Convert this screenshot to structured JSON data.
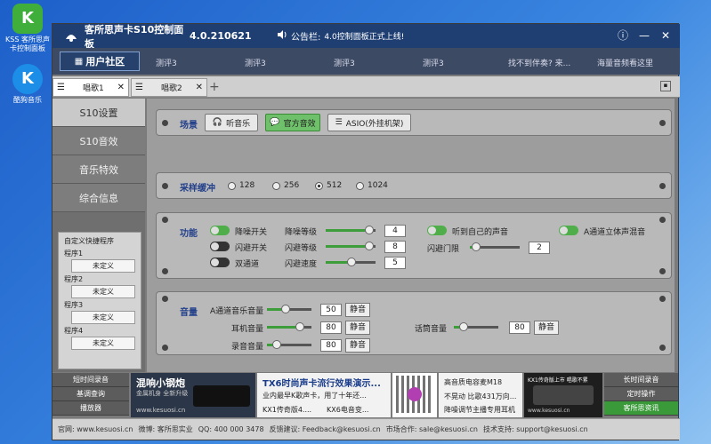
{
  "desktop": {
    "icons": [
      {
        "label": "KSS 客所思声卡控制面板",
        "glyph": "K"
      },
      {
        "label": "酷狗音乐",
        "glyph": "K"
      }
    ]
  },
  "titlebar": {
    "app_title": "客所思声卡S10控制面板",
    "version": "4.0.210621",
    "notice_label": "公告栏:",
    "notice_text": "4.0控制面板正式上线!",
    "info_glyph": "ⓘ",
    "minimize_glyph": "—",
    "close_glyph": "✕"
  },
  "navbar": {
    "community_label": "用户社区",
    "links": [
      "测评3",
      "测评3",
      "测评3",
      "测评3",
      "找不到伴奏? 来...",
      "海量音频看这里"
    ]
  },
  "tabs": [
    {
      "label": "唱歌1",
      "active": true
    },
    {
      "label": "唱歌2",
      "active": false
    }
  ],
  "sidebar": {
    "items": [
      {
        "label": "S10设置",
        "active": true
      },
      {
        "label": "S10音效",
        "active": false
      },
      {
        "label": "音乐特效",
        "active": false
      },
      {
        "label": "综合信息",
        "active": false
      }
    ],
    "shortcut_title": "自定义快捷程序",
    "programs": [
      {
        "label": "程序1",
        "button": "未定义"
      },
      {
        "label": "程序2",
        "button": "未定义"
      },
      {
        "label": "程序3",
        "button": "未定义"
      },
      {
        "label": "程序4",
        "button": "未定义"
      }
    ]
  },
  "scene": {
    "label": "场景",
    "buttons": [
      {
        "label": "听音乐",
        "icon": "headphones-icon",
        "active": false
      },
      {
        "label": "官方音效",
        "icon": "chat-icon",
        "active": true
      },
      {
        "label": "ASIO(外挂机架)",
        "icon": "sliders-icon",
        "active": false
      }
    ]
  },
  "sampling": {
    "label": "采样缓冲",
    "options": [
      "128",
      "256",
      "512",
      "1024"
    ],
    "selected": "512"
  },
  "function": {
    "label": "功能",
    "denoise_label": "降噪开关",
    "denoise_on": true,
    "denoise_level_label": "降噪等级",
    "denoise_level": "4",
    "flash_label": "闪避开关",
    "flash_on": false,
    "flash_level_label": "闪避等级",
    "flash_level": "8",
    "dual_label": "双通道",
    "dual_on": false,
    "flash_speed_label": "闪避速度",
    "flash_speed": "5",
    "hear_self_label": "听到自己的声音",
    "hear_self_on": true,
    "flash_threshold_label": "闪避门限",
    "flash_threshold": "2",
    "stereo_label": "A通道立体声混音",
    "stereo_on": true
  },
  "volume": {
    "label": "音量",
    "a_music_label": "A通道音乐音量",
    "a_music": "50",
    "earphone_label": "耳机音量",
    "earphone": "80",
    "record_label": "录音音量",
    "record": "80",
    "mic_label": "话筒音量",
    "mic": "80",
    "mute_label": "静音"
  },
  "footer_left": [
    "短时间录音",
    "基调查询",
    "播放器"
  ],
  "banners": {
    "b1_title": "混响小钢炮",
    "b1_sub": "金属机身 全新升级",
    "b1_site": "www.kesuosi.cn",
    "b2_title": "TX6时尚声卡流行效果演示...",
    "b2_line1": "业内最早K歌声卡，用了十年还...",
    "b2_line2a": "KX1传奇版4....",
    "b2_line2b": "KX6电音变...",
    "b3_line1": "高音质电容麦M18",
    "b3_line2": "不晃动 比歌431万向...",
    "b3_line3": "降噪调节主播专用耳机",
    "b4_title": "KX1传奇版上市 唱歌不累",
    "b4_site": "www.kesuosi.cn"
  },
  "footer_right": [
    "长时间录音",
    "定时操作",
    "客所思资讯"
  ],
  "statusbar": {
    "website": "官网: www.kesuosi.cn",
    "weibo": "微博: 客所思实业",
    "qq": "QQ: 400 000 3478",
    "feedback": "反馈建议: Feedback@kesuosi.cn",
    "market": "市场合作: sale@kesuosi.cn",
    "support": "技术支持: support@kesuosi.cn"
  }
}
